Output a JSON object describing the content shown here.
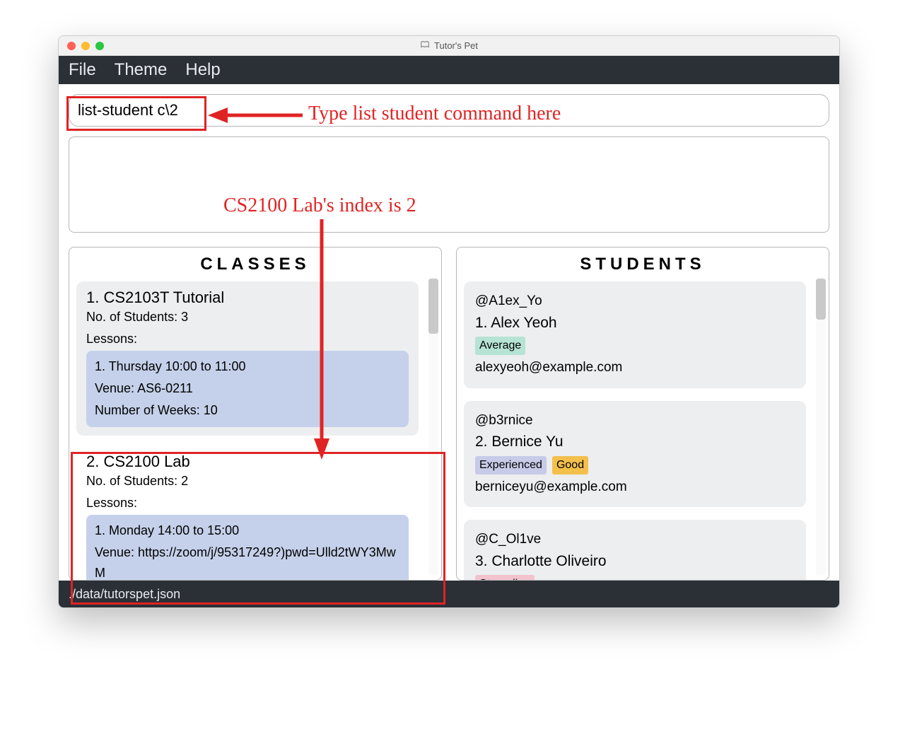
{
  "window": {
    "title": "Tutor's Pet"
  },
  "menubar": {
    "file": "File",
    "theme": "Theme",
    "help": "Help"
  },
  "command_input": {
    "value": "list-student c\\2"
  },
  "panels": {
    "classes": {
      "title": "CLASSES",
      "items": [
        {
          "title": "1.  CS2103T Tutorial",
          "students_line": "No. of Students:  3",
          "lessons_label": "Lessons:",
          "lesson": {
            "time": "1. Thursday 10:00 to 11:00",
            "venue": "Venue: AS6-0211",
            "weeks": "Number of Weeks: 10"
          }
        },
        {
          "title": "2.  CS2100 Lab",
          "students_line": "No. of Students:  2",
          "lessons_label": "Lessons:",
          "lesson": {
            "time": "1. Monday 14:00 to 15:00",
            "venue": "Venue: https://zoom/j/95317249?)pwd=Ulld2tWY3MwM",
            "weeks": ""
          }
        }
      ]
    },
    "students": {
      "title": "STUDENTS",
      "items": [
        {
          "handle": "@A1ex_Yo",
          "name": "1.  Alex Yeoh",
          "tags": [
            {
              "text": "Average",
              "cls": "tag-average"
            }
          ],
          "email": "alexyeoh@example.com"
        },
        {
          "handle": "@b3rnice",
          "name": "2.  Bernice Yu",
          "tags": [
            {
              "text": "Experienced",
              "cls": "tag-experienced"
            },
            {
              "text": "Good",
              "cls": "tag-good"
            }
          ],
          "email": "berniceyu@example.com"
        },
        {
          "handle": "@C_Ol1ve",
          "name": "3.  Charlotte Oliveiro",
          "tags": [
            {
              "text": "Struggling",
              "cls": "tag-struggling"
            }
          ],
          "email": ""
        }
      ]
    }
  },
  "statusbar": {
    "path": "./data/tutorspet.json"
  },
  "annotations": {
    "a1": "Type list student command here",
    "a2": "CS2100 Lab's index is 2"
  }
}
